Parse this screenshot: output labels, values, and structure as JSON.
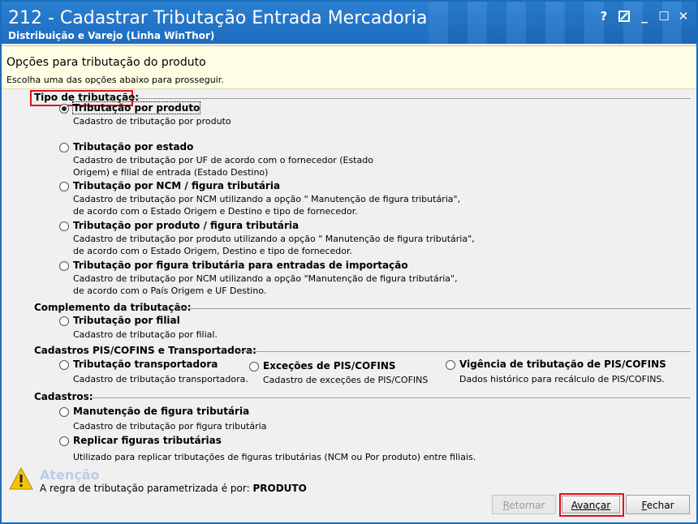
{
  "window": {
    "title": "212 - Cadastrar Tributação Entrada Mercadoria",
    "subtitle": "Distribuição e Varejo (Linha WinThor)",
    "controls": {
      "help": "?",
      "minimize": "_",
      "maximize": "☐",
      "close": "✕"
    }
  },
  "header": {
    "title": "Opções para tributação do produto",
    "subtitle": "Escolha uma das opções abaixo para prosseguir."
  },
  "sections": {
    "tipo": "Tipo de tributação:",
    "complemento": "Complemento da tributação:",
    "cadastros_pis": "Cadastros PIS/COFINS e Transportadora:",
    "cadastros": "Cadastros:"
  },
  "options": {
    "por_produto": {
      "label": "Tributação por produto",
      "desc1": "Cadastro de tributação por produto",
      "checked": true
    },
    "por_estado": {
      "label": "Tributação por estado",
      "desc1": "Cadastro de tributação por UF de acordo com o fornecedor (Estado",
      "desc2": "Origem) e filial de entrada (Estado Destino)"
    },
    "por_ncm": {
      "label": "Tributação por NCM / figura tributária",
      "desc1": "Cadastro de tributação por NCM utilizando a opção \" Manutenção de figura tributária\",",
      "desc2": "de acordo com o Estado Origem e Destino e tipo de fornecedor."
    },
    "produto_figura": {
      "label": "Tributação por produto / figura tributária",
      "desc1": "Cadastro de tributação por produto utilizando a opção \" Manutenção de figura tributária\",",
      "desc2": "de acordo com o Estado Origem, Destino e tipo de fornecedor."
    },
    "importacao": {
      "label": "Tributação por figura tributária para entradas de importação",
      "desc1": "Cadastro de tributação por NCM utilizando a opção \"Manutenção de figura tributária\",",
      "desc2": "de acordo com o País Origem e UF Destino."
    },
    "por_filial": {
      "label": "Tributação por filial",
      "desc1": "Cadastro de tributação por filial."
    },
    "transportadora": {
      "label": "Tributação  transportadora",
      "desc1": "Cadastro de tributação transportadora."
    },
    "excecoes_pis": {
      "label": "Exceções de PIS/COFINS",
      "desc1": "Cadastro de exceções de PIS/COFINS"
    },
    "vigencia_pis": {
      "label": "Vigência de tributação de PIS/COFINS",
      "desc1": "Dados histórico para recálculo de PIS/COFINS."
    },
    "manutencao_figura": {
      "label": "Manutenção de figura tributária",
      "desc1": "Cadastro de tributação por figura tributária"
    },
    "replicar_figuras": {
      "label": "Replicar figuras tributárias",
      "desc1": "Utilizado para replicar tributações de figuras tributárias (NCM ou Por produto) entre filiais."
    }
  },
  "attention": {
    "title": "Atenção",
    "text": "A regra de tributação parametrizada é por:",
    "value": "PRODUTO",
    "icon": "warning-icon"
  },
  "buttons": {
    "retornar_u": "R",
    "retornar_rest": "etornar",
    "avancar_u": "A",
    "avancar_rest": "vançar",
    "fechar_u": "F",
    "fechar_rest": "echar"
  },
  "colors": {
    "titlebar": "#1d6cc0",
    "highlight": "#e0101a",
    "header_bg": "#ffffe5"
  }
}
